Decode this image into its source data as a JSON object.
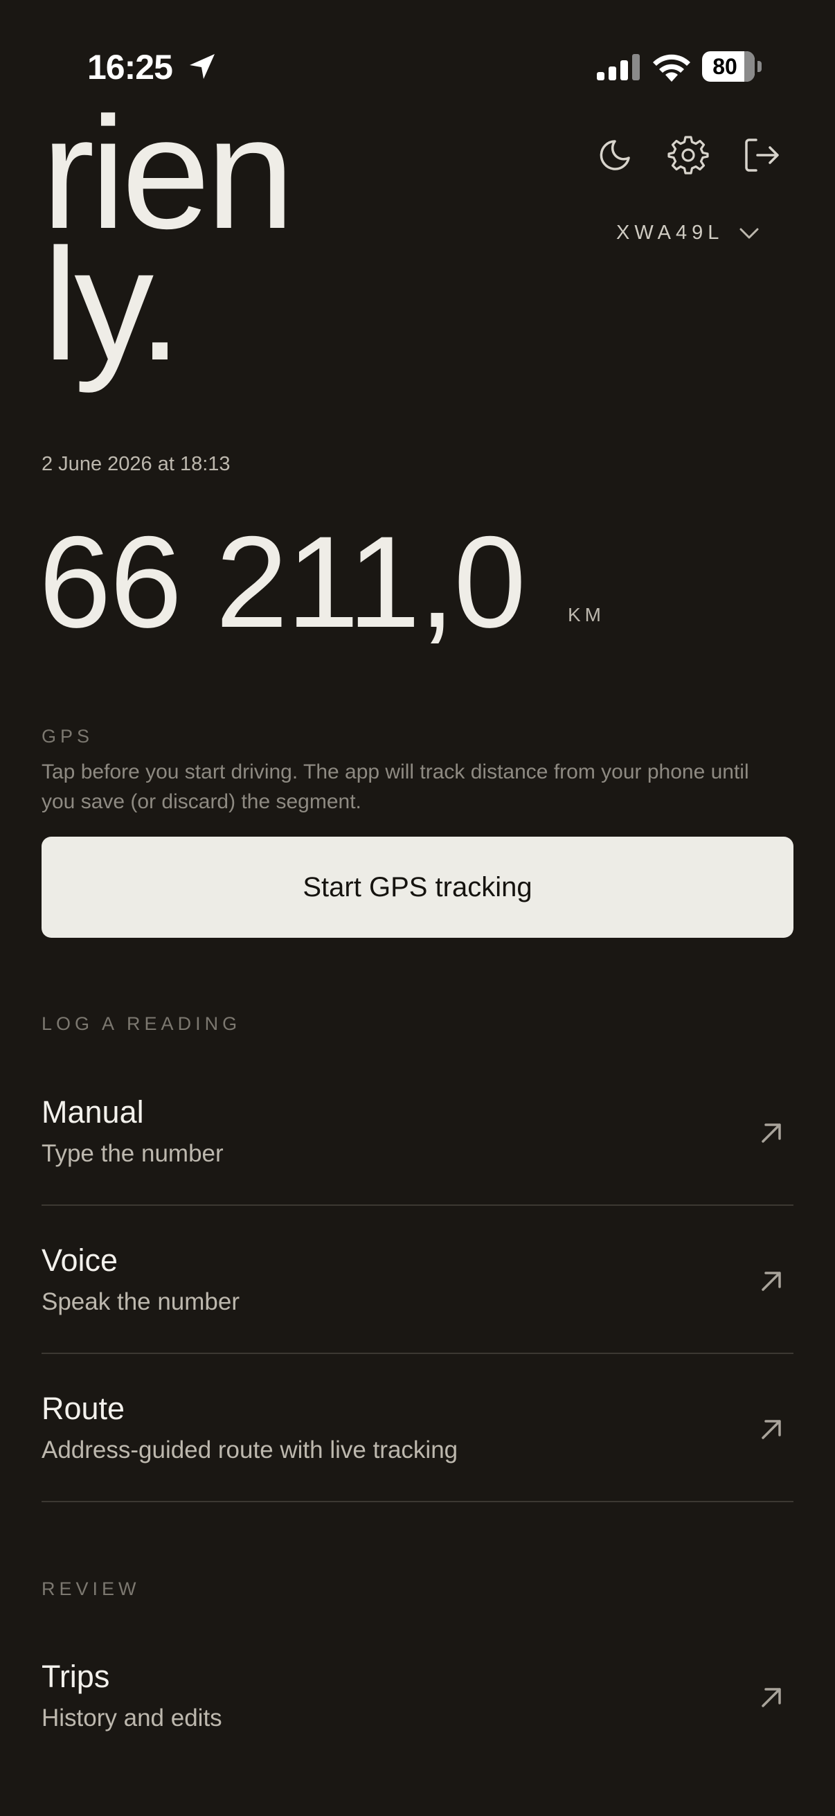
{
  "status_bar": {
    "time": "16:25",
    "battery": "80",
    "icons": [
      "location-arrow-icon",
      "signal-icon",
      "wifi-icon",
      "battery-icon"
    ]
  },
  "logo": {
    "line1": "rien",
    "line2": "ly."
  },
  "header": {
    "vehicle": "XWA49L",
    "icons": [
      "moon-icon",
      "gear-icon",
      "logout-icon",
      "chevron-down-icon"
    ]
  },
  "reading": {
    "date": "2 June 2026 at 18:13",
    "value": "66 211,0",
    "unit": "KM"
  },
  "gps": {
    "heading": "GPS",
    "description": "Tap before you start driving. The app will track distance from your phone until you save (or discard) the segment.",
    "button": "Start GPS tracking"
  },
  "log": {
    "heading": "LOG A READING",
    "items": [
      {
        "title": "Manual",
        "subtitle": "Type the number"
      },
      {
        "title": "Voice",
        "subtitle": "Speak the number"
      },
      {
        "title": "Route",
        "subtitle": "Address-guided route with live tracking"
      }
    ]
  },
  "review": {
    "heading": "REVIEW",
    "items": [
      {
        "title": "Trips",
        "subtitle": "History and edits"
      }
    ]
  },
  "colors": {
    "background": "#1a1713",
    "text": "#efede7",
    "muted": "#7c7870",
    "button": "#edece6"
  }
}
